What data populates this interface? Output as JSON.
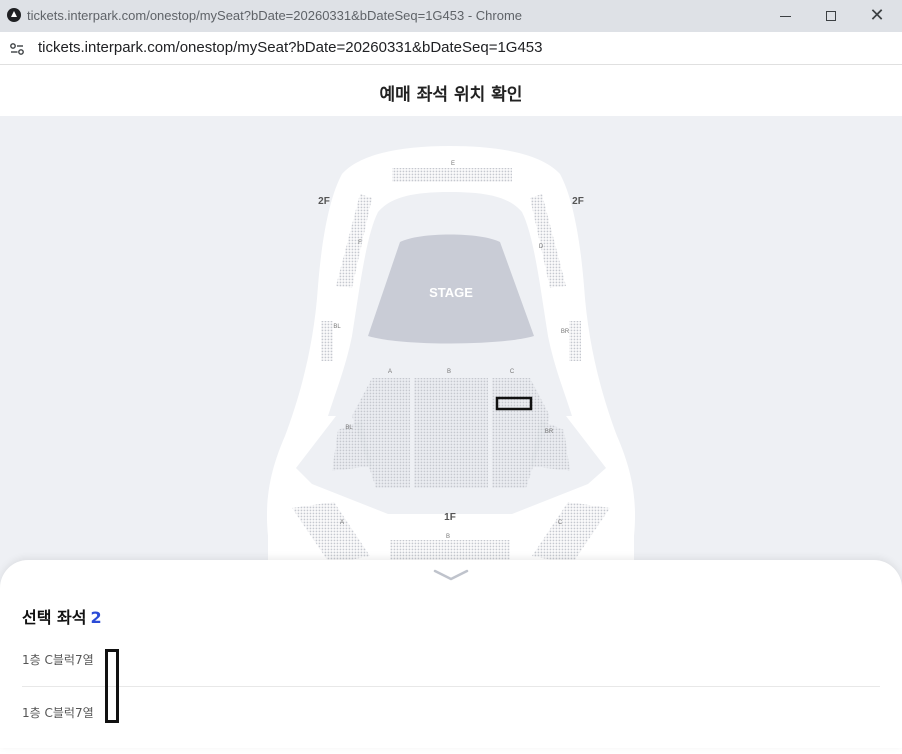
{
  "window": {
    "title": "tickets.interpark.com/onestop/mySeat?bDate=20260331&bDateSeq=1G453 - Chrome",
    "url": "tickets.interpark.com/onestop/mySeat?bDate=20260331&bDateSeq=1G453"
  },
  "page": {
    "title": "예매 좌석 위치 확인"
  },
  "map": {
    "stage_label": "STAGE",
    "floor2_left": "2F",
    "floor2_right": "2F",
    "floor1_label": "1F",
    "balcony_top": "E",
    "balcony_left": "F",
    "balcony_right": "D",
    "side_left": "BL",
    "side_right": "BR",
    "block_a": "A",
    "block_b": "B",
    "block_c": "C",
    "wing_left": "BL",
    "wing_right": "BR",
    "lower_a": "A",
    "lower_b": "B",
    "lower_c": "C",
    "colors": {
      "background": "#eef0f4",
      "hall": "#ffffff",
      "stage": "#c9ccd6",
      "seat": "#c5c8cf"
    }
  },
  "sheet": {
    "title": "선택 좌석",
    "count": "2",
    "seats": [
      {
        "label": "1층 C블럭7열"
      },
      {
        "label": "1층 C블럭7열"
      }
    ],
    "accent": "#2b4bd6"
  }
}
